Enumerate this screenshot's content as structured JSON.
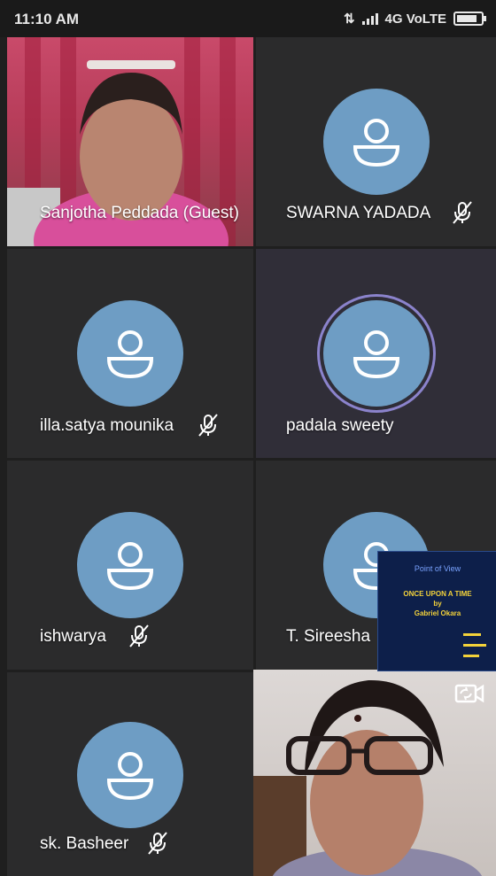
{
  "status_bar": {
    "time": "11:10 AM",
    "network": "4G VoLTE"
  },
  "participants": [
    {
      "name": "Sanjotha Peddada (Guest)",
      "type": "video",
      "muted": false
    },
    {
      "name": "SWARNA YADADA",
      "type": "avatar",
      "muted": true
    },
    {
      "name": "illa.satya mounika",
      "type": "avatar",
      "muted": true
    },
    {
      "name": "padala sweety",
      "type": "avatar",
      "muted": false,
      "speaking": true
    },
    {
      "name": "ishwarya",
      "type": "avatar",
      "muted": true
    },
    {
      "name": "T. Sireesha",
      "type": "avatar",
      "muted": false
    },
    {
      "name": "sk. Basheer",
      "type": "avatar",
      "muted": true
    },
    {
      "name": "",
      "type": "video",
      "muted": false
    }
  ],
  "screen_share_thumbnail": {
    "heading": "Point of View",
    "title_line1": "ONCE UPON A TIME",
    "title_line2": "by",
    "title_line3": "Gabriel Okara"
  },
  "icons": {
    "mic_muted": "mic-off-icon",
    "avatar": "person-icon",
    "camera_switch": "camera-switch-icon"
  },
  "colors": {
    "avatar_bg": "#6e9dc4",
    "tile_bg": "#2b2b2c",
    "speaking_ring": "#8b83cc"
  }
}
